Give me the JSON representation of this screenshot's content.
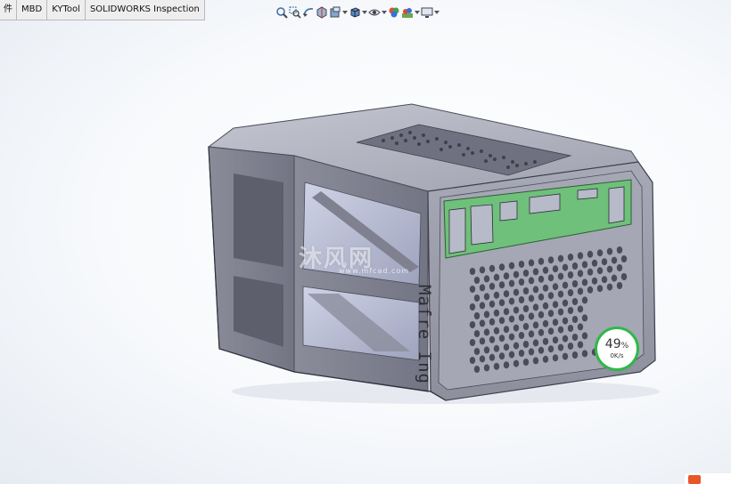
{
  "tabs": [
    {
      "label": "件"
    },
    {
      "label": "MBD"
    },
    {
      "label": "KYTool"
    },
    {
      "label": "SOLIDWORKS Inspection"
    }
  ],
  "heads_up_toolbar": [
    {
      "icon": "zoom-to-fit-icon",
      "has_dropdown": false
    },
    {
      "icon": "zoom-to-area-icon",
      "has_dropdown": false
    },
    {
      "icon": "previous-view-icon",
      "has_dropdown": false
    },
    {
      "icon": "section-view-icon",
      "has_dropdown": false
    },
    {
      "icon": "dynamic-annotation-icon",
      "has_dropdown": true
    },
    {
      "icon": "view-orientation-icon",
      "has_dropdown": true
    },
    {
      "icon": "display-style-icon",
      "has_dropdown": true
    },
    {
      "icon": "hide-show-items-icon",
      "has_dropdown": true
    },
    {
      "icon": "edit-appearance-icon",
      "has_dropdown": false
    },
    {
      "icon": "apply-scene-icon",
      "has_dropdown": true
    },
    {
      "icon": "view-settings-icon",
      "has_dropdown": true
    }
  ],
  "model": {
    "engraving": "Mafre Ing",
    "body_color": "#8e909e",
    "panel_color": "#6fc07a"
  },
  "watermark": {
    "text": "沐风网",
    "url": "www.mfcad.com"
  },
  "network_monitor": {
    "percent": "49",
    "percent_unit": "%",
    "speed": "0K/s",
    "ring_color": "#2fb84a"
  }
}
